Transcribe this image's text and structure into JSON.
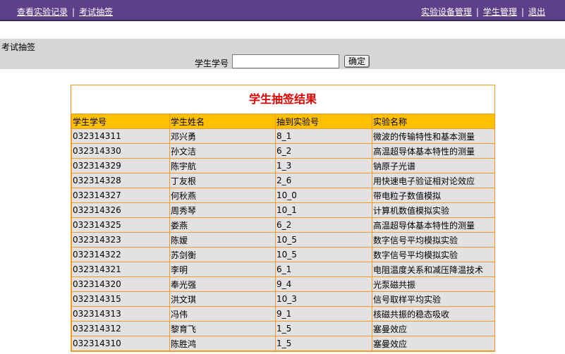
{
  "nav": {
    "left_links": [
      "查看实验记录",
      "考试抽签"
    ],
    "right_links": [
      "实验设备管理",
      "学生管理",
      "退出"
    ],
    "separator": "|"
  },
  "search": {
    "section_label": "考试抽签",
    "field_label": "学生学号",
    "input_value": "",
    "button_label": "确定"
  },
  "results": {
    "title": "学生抽签结果",
    "columns": [
      "学生学号",
      "学生姓名",
      "抽到实验号",
      "实验名称"
    ],
    "rows": [
      [
        "032314311",
        "邓兴勇",
        "8_1",
        "微波的传输特性和基本测量"
      ],
      [
        "032314330",
        "孙文洁",
        "6_2",
        "高温超导体基本特性的测量"
      ],
      [
        "032314329",
        "陈宇航",
        "1_3",
        "钠原子光谱"
      ],
      [
        "032314328",
        "丁友根",
        "2_6",
        "用快速电子验证相对论效应"
      ],
      [
        "032314327",
        "何秋燕",
        "10_0",
        "带电粒子数值模拟"
      ],
      [
        "032314326",
        "周秀琴",
        "10_1",
        "计算机数值模拟实验"
      ],
      [
        "032314325",
        "娄燕",
        "6_2",
        "高温超导体基本特性的测量"
      ],
      [
        "032314323",
        "陈嫒",
        "10_5",
        "数字信号平均模拟实验"
      ],
      [
        "032314322",
        "苏剑衡",
        "10_5",
        "数字信号平均模拟实验"
      ],
      [
        "032314321",
        "李明",
        "6_1",
        "电阻温度关系和减压降温技术"
      ],
      [
        "032314320",
        "奉光强",
        "9_4",
        "光泵磁共振"
      ],
      [
        "032314315",
        "洪文琪",
        "10_3",
        "信号取样平均实验"
      ],
      [
        "032314313",
        "冯伟",
        "9_1",
        "核磁共振的稳态吸收"
      ],
      [
        "032314312",
        "黎育飞",
        "1_5",
        "塞曼效应"
      ],
      [
        "032314310",
        "陈胜鸿",
        "1_5",
        "塞曼效应"
      ]
    ]
  }
}
